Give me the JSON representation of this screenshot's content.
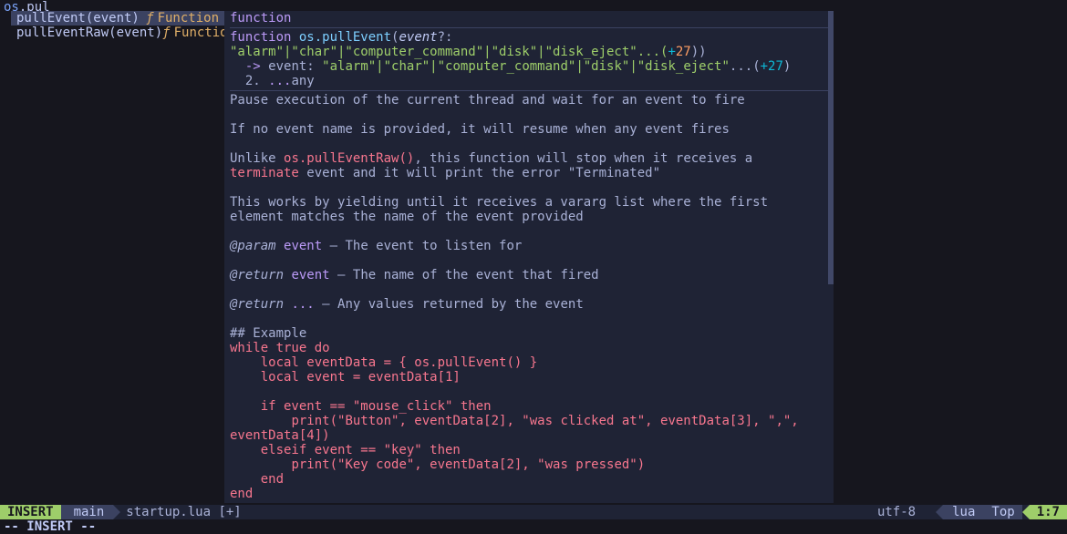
{
  "editor": {
    "line1_ns": "os",
    "line1_typed": "pul"
  },
  "completion": {
    "items": [
      {
        "label": "pullEvent(event)",
        "kind_sym": "ƒ",
        "kind": "Function",
        "selected": true
      },
      {
        "label": "pullEventRaw(event)",
        "kind_sym": "ƒ",
        "kind": "Function",
        "selected": false
      }
    ]
  },
  "doc": {
    "title": "function",
    "sig_kw": "function",
    "sig_fn": "os.pullEvent",
    "sig_open": "(",
    "sig_param": "event",
    "sig_opt": "?:",
    "sig_types": " \"alarm\"|\"char\"|\"computer_command\"|\"disk\"|\"disk_eject\"...(",
    "sig_plus": "+",
    "sig_count": "27",
    "sig_close": "))",
    "rarrow": "  -> ",
    "rname": "event: ",
    "rtypes": "\"alarm\"|\"char\"|\"computer_command\"|\"disk\"|\"disk_eject\"",
    "rdots": "...(",
    "rplus": "+27",
    "rclose": ")",
    "r2_head": "  2. ",
    "r2_dots": "...",
    "r2_any": "any",
    "body1": "Pause execution of the current thread and wait for an event to fire",
    "body2": "If no event name is provided, it will resume when any event fires",
    "body3a": "Unlike ",
    "body3_link": "os.pullEventRaw()",
    "body3b": ", this function will stop when it receives a ",
    "body3_link2": "terminate",
    "body3c": " event and it will print the error \"Terminated\"",
    "body4": "This works by yielding until it receives a vararg list where the first element matches the name of the event provided",
    "p_tag": "@param",
    "p_name": "event",
    "p_desc": " — The event to listen for",
    "r_tag": "@return",
    "r_name": "event",
    "r_desc": " — The name of the event that fired",
    "r2_tag": "@return",
    "r2_name": "...",
    "r2_desc": " — Any values returned by the event",
    "ex_head": "## Example",
    "ex1": "while true do",
    "ex2": "    local eventData = { os.pullEvent() }",
    "ex3": "    local event = eventData[1]",
    "ex4": "    if event == \"mouse_click\" then",
    "ex5": "        print(\"Button\", eventData[2], \"was clicked at\", eventData[3], \",\", eventData[4])",
    "ex6": "    elseif event == \"key\" then",
    "ex7": "        print(\"Key code\", eventData[2], \"was pressed\")",
    "ex8": "    end",
    "ex9": "end"
  },
  "statusline": {
    "mode": "INSERT",
    "branch_icon": "",
    "branch": "main",
    "file": "startup.lua",
    "modified": "[+]",
    "encoding": "utf-8",
    "sep": "",
    "ff_icon": "",
    "sep2": "",
    "lang_icon": "",
    "lang": "lua",
    "percent": "Top",
    "pos": "1:7"
  },
  "cmdline": {
    "text": "-- INSERT --"
  }
}
